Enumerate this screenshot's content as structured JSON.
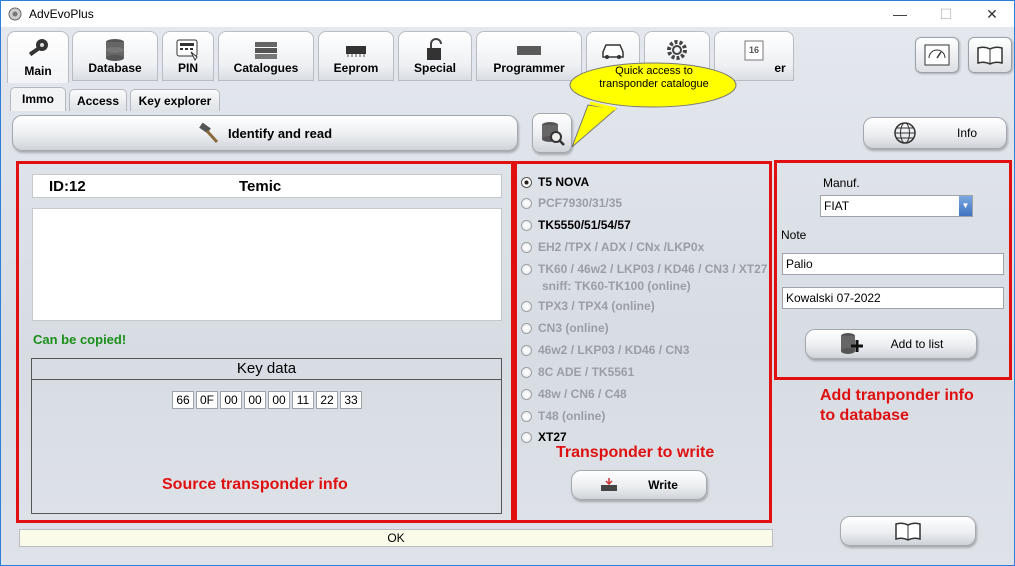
{
  "window": {
    "title": "AdvEvoPlus",
    "minimize": "—",
    "maximize": "☐",
    "close": "✕"
  },
  "top_buttons": [
    {
      "label": "Main",
      "icon": "key-icon"
    },
    {
      "label": "Database",
      "icon": "database-icon"
    },
    {
      "label": "PIN",
      "icon": "keypad-icon"
    },
    {
      "label": "Catalogues",
      "icon": "books-icon"
    },
    {
      "label": "Eeprom",
      "icon": "chip-icon"
    },
    {
      "label": "Special",
      "icon": "padlock-icon"
    },
    {
      "label": "Programmer",
      "icon": "programmer-icon"
    },
    {
      "label": "",
      "icon": "car-icon"
    },
    {
      "label": "",
      "icon": "gear-icon"
    },
    {
      "label": "er",
      "icon": "calendar-icon",
      "calendar_day": "16"
    }
  ],
  "callout": {
    "text": "Quick access to transponder catalogue"
  },
  "subtabs": [
    "Immo",
    "Access",
    "Key explorer"
  ],
  "identify_button": "Identify and read",
  "info_button": "Info",
  "source": {
    "id": "ID:12",
    "manufacturer": "Temic",
    "status": "Can be copied!",
    "key_data_title": "Key data",
    "key_bytes": [
      "66",
      "0F",
      "00",
      "00",
      "00",
      "11",
      "22",
      "33"
    ],
    "label": "Source transponder info"
  },
  "transponders": [
    {
      "label": "T5 NOVA",
      "selected": true,
      "enabled": true
    },
    {
      "label": "PCF7930/31/35",
      "selected": false,
      "enabled": false
    },
    {
      "label": "TK5550/51/54/57",
      "selected": false,
      "enabled": true
    },
    {
      "label": "EH2 /TPX / ADX / CNx /LKP0x",
      "selected": false,
      "enabled": false
    },
    {
      "label": "TK60 / 46w2 / LKP03 / KD46 / CN3 / XT27",
      "sub": "sniff: TK60-TK100 (online)",
      "selected": false,
      "enabled": false
    },
    {
      "label": "TPX3 / TPX4 (online)",
      "selected": false,
      "enabled": false
    },
    {
      "label": "CN3 (online)",
      "selected": false,
      "enabled": false
    },
    {
      "label": "46w2 / LKP03 / KD46 / CN3",
      "selected": false,
      "enabled": false
    },
    {
      "label": "8C ADE / TK5561",
      "selected": false,
      "enabled": false
    },
    {
      "label": "48w / CN6 / C48",
      "selected": false,
      "enabled": false
    },
    {
      "label": "T48 (online)",
      "selected": false,
      "enabled": false
    },
    {
      "label": "XT27",
      "selected": false,
      "enabled": true
    }
  ],
  "write_section": {
    "label": "Transponder to write",
    "button": "Write"
  },
  "database_panel": {
    "manuf_label": "Manuf.",
    "manuf_value": "FIAT",
    "note_label": "Note",
    "note1": "Palio",
    "note2": "Kowalski 07-2022",
    "add_button": "Add to list",
    "label_line1": "Add tranponder info",
    "label_line2": "to database"
  },
  "status_bar": "OK"
}
